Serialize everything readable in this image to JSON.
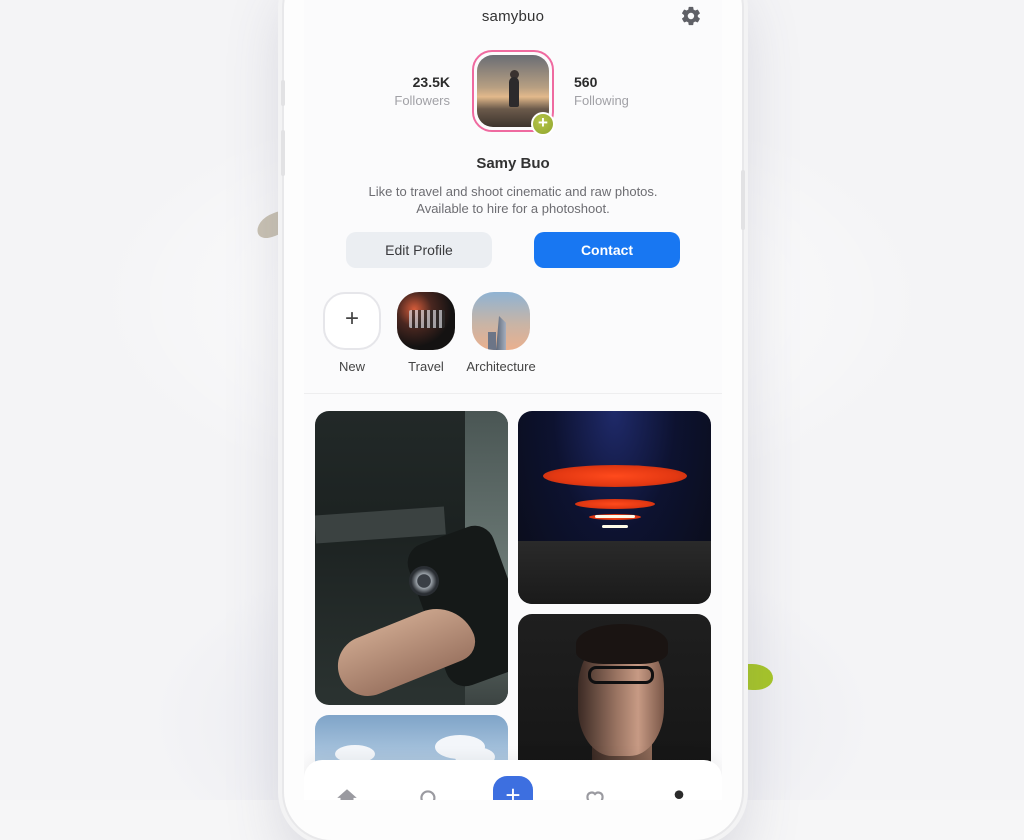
{
  "header": {
    "username": "samybuo",
    "settings_icon": "gear-icon"
  },
  "profile": {
    "followers_count": "23.5K",
    "followers_label": "Followers",
    "following_count": "560",
    "following_label": "Following",
    "name": "Samy Buo",
    "bio_line1": "Like to travel and shoot cinematic and raw photos.",
    "bio_line2": "Available to hire for a photoshoot.",
    "add_badge": "+"
  },
  "actions": {
    "edit_label": "Edit Profile",
    "contact_label": "Contact"
  },
  "highlights": [
    {
      "label": "New",
      "icon": "plus-icon"
    },
    {
      "label": "Travel"
    },
    {
      "label": "Architecture"
    }
  ],
  "bottom_nav": {
    "items": [
      "home-icon",
      "search-icon",
      "add-icon",
      "heart-icon",
      "profile-icon"
    ],
    "add_glyph": "+"
  },
  "colors": {
    "accent": "#1877f2",
    "avatar_ring": "#ef6aa0",
    "add_badge": "#9bb038"
  }
}
